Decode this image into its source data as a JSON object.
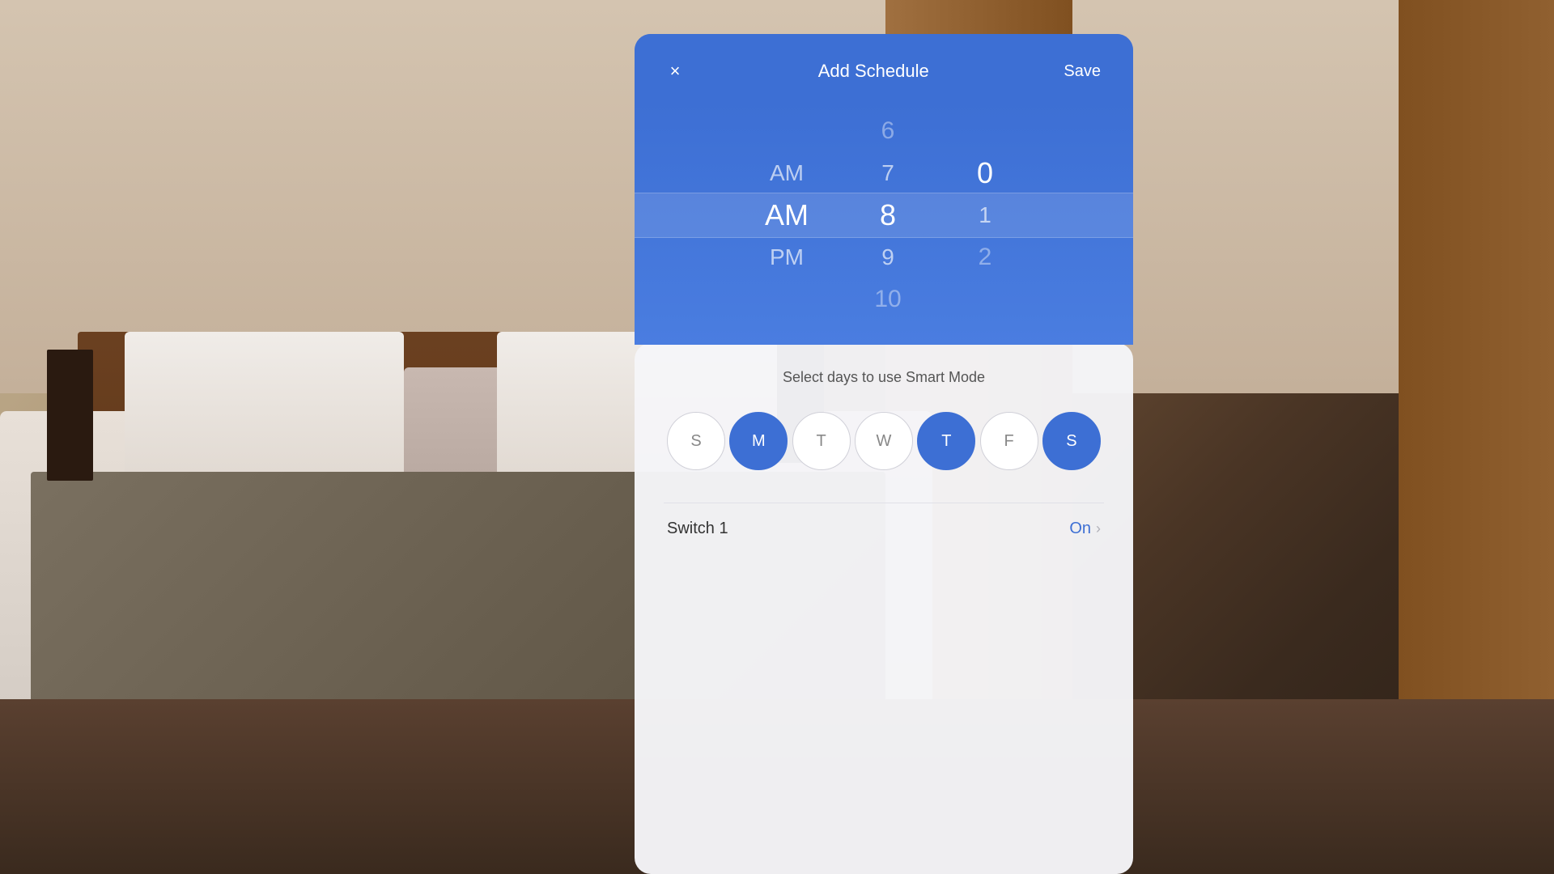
{
  "background": {
    "description": "Hotel bedroom with warm tones"
  },
  "panel": {
    "header": {
      "close_label": "×",
      "title": "Add Schedule",
      "save_label": "Save"
    },
    "time_picker": {
      "ampm_options": [
        "AM",
        "PM"
      ],
      "ampm_selected": "AM",
      "hours": [
        "6",
        "7",
        "8",
        "9",
        "10"
      ],
      "hours_selected": "8",
      "minutes": [
        "0",
        "1",
        "2"
      ],
      "minutes_selected": "0"
    },
    "bottom": {
      "smart_mode_title": "Select days to use Smart Mode",
      "days": [
        {
          "label": "S",
          "id": "sunday",
          "active": false
        },
        {
          "label": "M",
          "id": "monday",
          "active": true
        },
        {
          "label": "T",
          "id": "tuesday",
          "active": false
        },
        {
          "label": "W",
          "id": "wednesday",
          "active": false
        },
        {
          "label": "T",
          "id": "thursday",
          "active": true
        },
        {
          "label": "F",
          "id": "friday",
          "active": false
        },
        {
          "label": "S",
          "id": "saturday",
          "active": true
        }
      ],
      "switch_row": {
        "label": "Switch 1",
        "value": "On"
      }
    }
  }
}
